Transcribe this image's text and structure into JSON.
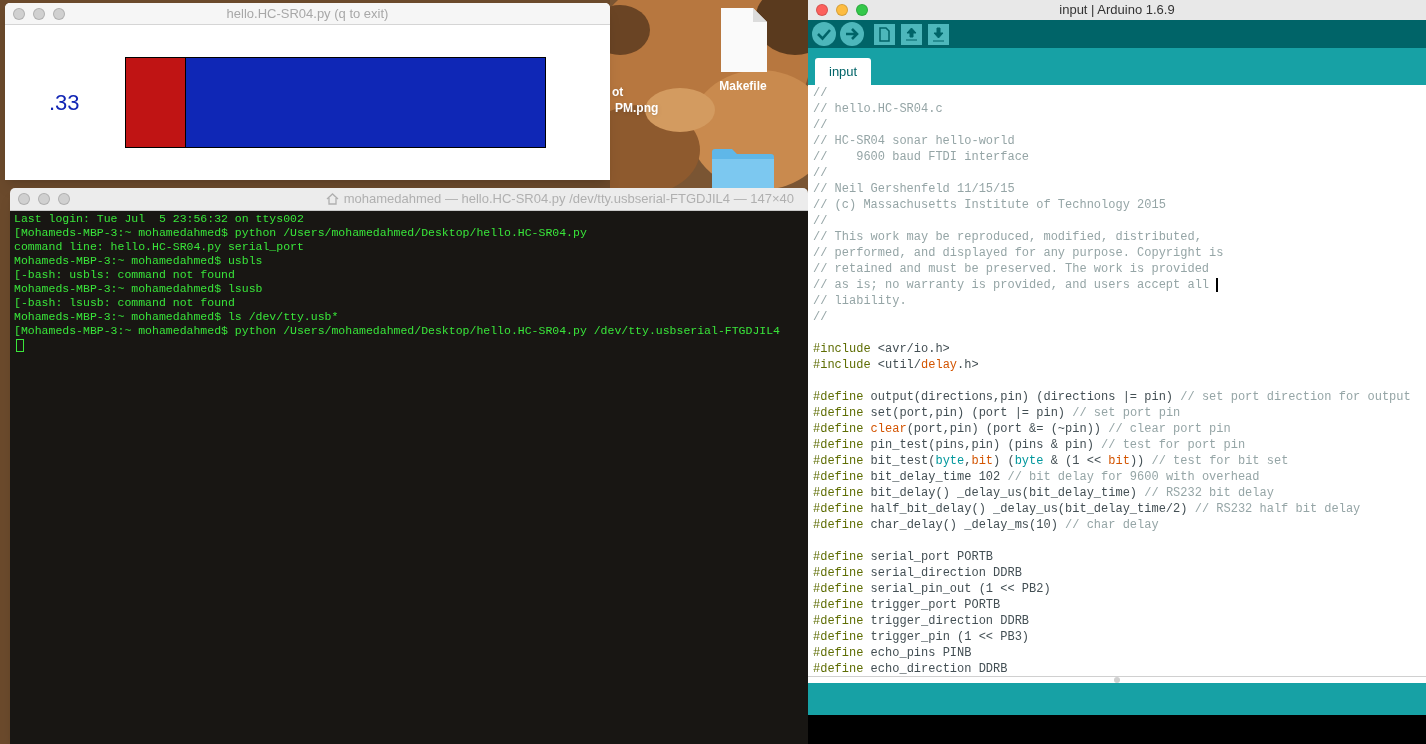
{
  "desktop": {
    "icons": [
      {
        "label_lines": [
          "ot",
          "PM.png"
        ]
      },
      {
        "kind": "file",
        "label_lines": [
          "Makefile"
        ]
      },
      {
        "kind": "folder"
      }
    ]
  },
  "python_window": {
    "title": "hello.HC-SR04.py (q to exit)",
    "reading": ".33",
    "level": 0.143
  },
  "terminal": {
    "title": "mohamedahmed — hello.HC-SR04.py /dev/tty.usbserial-FTGDJIL4 — 147×40",
    "lines": [
      "Last login: Tue Jul  5 23:56:32 on ttys002",
      "[Mohameds-MBP-3:~ mohamedahmed$ python /Users/mohamedahmed/Desktop/hello.HC-SR04.py",
      "command line: hello.HC-SR04.py serial_port",
      "Mohameds-MBP-3:~ mohamedahmed$ usbls",
      "[-bash: usbls: command not found",
      "Mohameds-MBP-3:~ mohamedahmed$ lsusb",
      "[-bash: lsusb: command not found",
      "Mohameds-MBP-3:~ mohamedahmed$ ls /dev/tty.usb*",
      "[Mohameds-MBP-3:~ mohamedahmed$ python /Users/mohamedahmed/Desktop/hello.HC-SR04.py /dev/tty.usbserial-FTGDJIL4"
    ]
  },
  "arduino": {
    "title": "input | Arduino 1.6.9",
    "toolbar": [
      {
        "kind": "verify"
      },
      {
        "kind": "upload"
      },
      {
        "kind": "new"
      },
      {
        "kind": "open"
      },
      {
        "kind": "save"
      }
    ],
    "tabs": [
      {
        "label": "input",
        "selected": true
      }
    ],
    "code": [
      {
        "kind": "code",
        "tokens": [
          {
            "kind": "comment",
            "text": "//"
          }
        ]
      },
      {
        "kind": "code",
        "tokens": [
          {
            "kind": "comment",
            "text": "// hello.HC-SR04.c"
          }
        ]
      },
      {
        "kind": "code",
        "tokens": [
          {
            "kind": "comment",
            "text": "//"
          }
        ]
      },
      {
        "kind": "code",
        "tokens": [
          {
            "kind": "comment",
            "text": "// HC-SR04 sonar hello-world"
          }
        ]
      },
      {
        "kind": "code",
        "tokens": [
          {
            "kind": "comment",
            "text": "//    9600 baud FTDI interface"
          }
        ]
      },
      {
        "kind": "code",
        "tokens": [
          {
            "kind": "comment",
            "text": "//"
          }
        ]
      },
      {
        "kind": "code",
        "tokens": [
          {
            "kind": "comment",
            "text": "// Neil Gershenfeld 11/15/15"
          }
        ]
      },
      {
        "kind": "code",
        "tokens": [
          {
            "kind": "comment",
            "text": "// (c) Massachusetts Institute of Technology 2015"
          }
        ]
      },
      {
        "kind": "code",
        "tokens": [
          {
            "kind": "comment",
            "text": "//"
          }
        ]
      },
      {
        "kind": "code",
        "tokens": [
          {
            "kind": "comment",
            "text": "// This work may be reproduced, modified, distributed,"
          }
        ]
      },
      {
        "kind": "code",
        "tokens": [
          {
            "kind": "comment",
            "text": "// performed, and displayed for any purpose. Copyright is"
          }
        ]
      },
      {
        "kind": "code",
        "tokens": [
          {
            "kind": "comment",
            "text": "// retained and must be preserved. The work is provided"
          }
        ]
      },
      {
        "kind": "code",
        "caret": true,
        "tokens": [
          {
            "kind": "comment",
            "text": "// as is; no warranty is provided, and users accept all"
          }
        ]
      },
      {
        "kind": "code",
        "tokens": [
          {
            "kind": "comment",
            "text": "// liability."
          }
        ]
      },
      {
        "kind": "code",
        "tokens": [
          {
            "kind": "comment",
            "text": "//"
          }
        ]
      },
      {
        "kind": "blank"
      },
      {
        "kind": "code",
        "tokens": [
          {
            "kind": "directive",
            "text": "#include"
          },
          {
            "kind": "plain",
            "text": " <avr/io.h>"
          }
        ]
      },
      {
        "kind": "code",
        "tokens": [
          {
            "kind": "directive",
            "text": "#include"
          },
          {
            "kind": "plain",
            "text": " <util/"
          },
          {
            "kind": "keyword",
            "text": "delay"
          },
          {
            "kind": "plain",
            "text": ".h>"
          }
        ]
      },
      {
        "kind": "blank"
      },
      {
        "kind": "code",
        "tokens": [
          {
            "kind": "directive",
            "text": "#define"
          },
          {
            "kind": "plain",
            "text": " output(directions,pin) (directions |= pin) "
          },
          {
            "kind": "comment",
            "text": "// set port direction for output"
          }
        ]
      },
      {
        "kind": "code",
        "tokens": [
          {
            "kind": "directive",
            "text": "#define"
          },
          {
            "kind": "plain",
            "text": " set(port,pin) (port |= pin) "
          },
          {
            "kind": "comment",
            "text": "// set port pin"
          }
        ]
      },
      {
        "kind": "code",
        "tokens": [
          {
            "kind": "directive",
            "text": "#define "
          },
          {
            "kind": "keyword",
            "text": "clear"
          },
          {
            "kind": "plain",
            "text": "(port,pin) (port &= (~pin)) "
          },
          {
            "kind": "comment",
            "text": "// clear port pin"
          }
        ]
      },
      {
        "kind": "code",
        "tokens": [
          {
            "kind": "directive",
            "text": "#define"
          },
          {
            "kind": "plain",
            "text": " pin_test(pins,pin) (pins & pin) "
          },
          {
            "kind": "comment",
            "text": "// test for port pin"
          }
        ]
      },
      {
        "kind": "code",
        "tokens": [
          {
            "kind": "directive",
            "text": "#define"
          },
          {
            "kind": "plain",
            "text": " bit_test("
          },
          {
            "kind": "type",
            "text": "byte"
          },
          {
            "kind": "plain",
            "text": ","
          },
          {
            "kind": "keyword",
            "text": "bit"
          },
          {
            "kind": "plain",
            "text": ") ("
          },
          {
            "kind": "type",
            "text": "byte"
          },
          {
            "kind": "plain",
            "text": " & (1 << "
          },
          {
            "kind": "keyword",
            "text": "bit"
          },
          {
            "kind": "plain",
            "text": ")) "
          },
          {
            "kind": "comment",
            "text": "// test for bit set"
          }
        ]
      },
      {
        "kind": "code",
        "tokens": [
          {
            "kind": "directive",
            "text": "#define"
          },
          {
            "kind": "plain",
            "text": " bit_delay_time 102 "
          },
          {
            "kind": "comment",
            "text": "// bit delay for 9600 with overhead"
          }
        ]
      },
      {
        "kind": "code",
        "tokens": [
          {
            "kind": "directive",
            "text": "#define"
          },
          {
            "kind": "plain",
            "text": " bit_delay() _delay_us(bit_delay_time) "
          },
          {
            "kind": "comment",
            "text": "// RS232 bit delay"
          }
        ]
      },
      {
        "kind": "code",
        "tokens": [
          {
            "kind": "directive",
            "text": "#define"
          },
          {
            "kind": "plain",
            "text": " half_bit_delay() _delay_us(bit_delay_time/2) "
          },
          {
            "kind": "comment",
            "text": "// RS232 half bit delay"
          }
        ]
      },
      {
        "kind": "code",
        "tokens": [
          {
            "kind": "directive",
            "text": "#define"
          },
          {
            "kind": "plain",
            "text": " char_delay() _delay_ms(10) "
          },
          {
            "kind": "comment",
            "text": "// char delay"
          }
        ]
      },
      {
        "kind": "blank"
      },
      {
        "kind": "code",
        "tokens": [
          {
            "kind": "directive",
            "text": "#define"
          },
          {
            "kind": "plain",
            "text": " serial_port PORTB"
          }
        ]
      },
      {
        "kind": "code",
        "tokens": [
          {
            "kind": "directive",
            "text": "#define"
          },
          {
            "kind": "plain",
            "text": " serial_direction DDRB"
          }
        ]
      },
      {
        "kind": "code",
        "tokens": [
          {
            "kind": "directive",
            "text": "#define"
          },
          {
            "kind": "plain",
            "text": " serial_pin_out (1 << PB2)"
          }
        ]
      },
      {
        "kind": "code",
        "tokens": [
          {
            "kind": "directive",
            "text": "#define"
          },
          {
            "kind": "plain",
            "text": " trigger_port PORTB"
          }
        ]
      },
      {
        "kind": "code",
        "tokens": [
          {
            "kind": "directive",
            "text": "#define"
          },
          {
            "kind": "plain",
            "text": " trigger_direction DDRB"
          }
        ]
      },
      {
        "kind": "code",
        "tokens": [
          {
            "kind": "directive",
            "text": "#define"
          },
          {
            "kind": "plain",
            "text": " trigger_pin (1 << PB3)"
          }
        ]
      },
      {
        "kind": "code",
        "tokens": [
          {
            "kind": "directive",
            "text": "#define"
          },
          {
            "kind": "plain",
            "text": " echo_pins PINB"
          }
        ]
      },
      {
        "kind": "code",
        "tokens": [
          {
            "kind": "directive",
            "text": "#define"
          },
          {
            "kind": "plain",
            "text": " echo_direction DDRB"
          }
        ]
      }
    ]
  }
}
